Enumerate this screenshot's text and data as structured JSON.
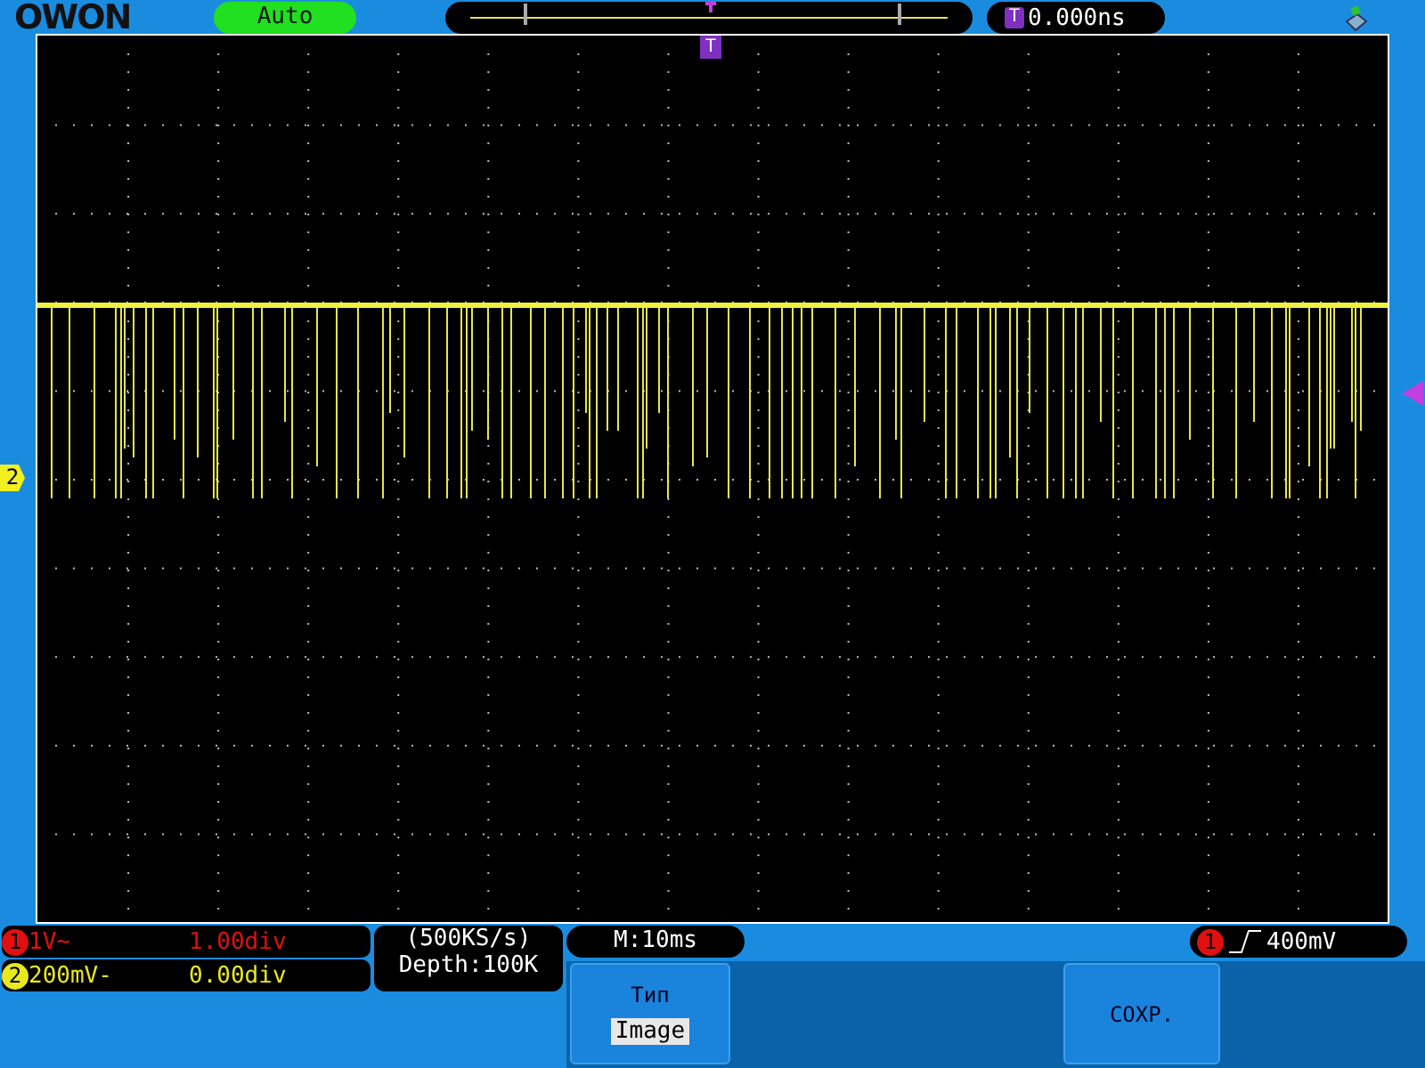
{
  "header": {
    "logo": "OWON",
    "run_mode": "Auto",
    "trigger_time": "0.000ns",
    "trigger_marker": "T"
  },
  "screen": {
    "channel_marker": "2",
    "top_marker": "T"
  },
  "channels": [
    {
      "number": "1",
      "scale": "1V~",
      "offset": "1.00div",
      "color": "#e01010"
    },
    {
      "number": "2",
      "scale": "200mV-",
      "offset": "0.00div",
      "color": "#e8e820"
    }
  ],
  "acquisition": {
    "sample_rate": "(500KS/s)",
    "depth": "Depth:100K"
  },
  "timebase": "M:10ms",
  "trigger": {
    "source": "1",
    "level": "400mV"
  },
  "menu": [
    {
      "kind": "option",
      "title": "Тип",
      "value": "Image"
    },
    {
      "kind": "action",
      "label": "COXP."
    }
  ]
}
